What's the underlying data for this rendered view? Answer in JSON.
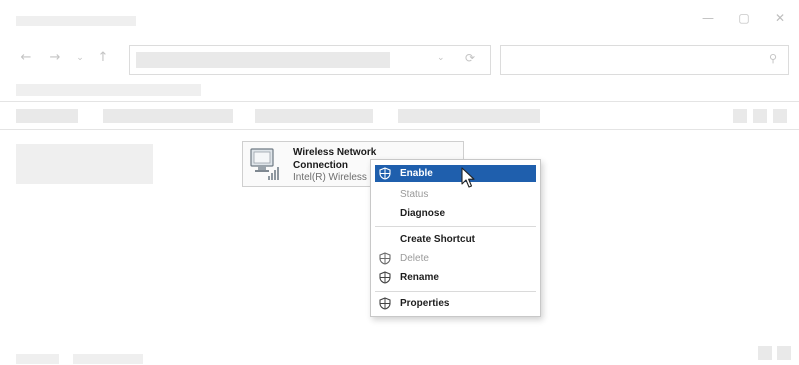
{
  "window": {
    "controls": {
      "minimize": "—",
      "maximize": "▢",
      "close": "✕"
    }
  },
  "navigation": {
    "back": "←",
    "forward": "→",
    "recent": "⌄",
    "up": "↑",
    "address_dropdown": "⌄",
    "refresh": "⟳",
    "search_glyph": "⚲"
  },
  "network_tile": {
    "name": "Wireless Network Connection",
    "adapter": "Intel(R) Wireless",
    "icon": "wireless-adapter-icon"
  },
  "context_menu": {
    "items": [
      {
        "label": "Enable",
        "icon": "shield-icon",
        "state": "highlighted"
      },
      {
        "label": "Status",
        "state": "disabled"
      },
      {
        "label": "Diagnose",
        "state": "enabled"
      },
      {
        "label": "Create Shortcut",
        "state": "enabled"
      },
      {
        "label": "Delete",
        "icon": "shield-icon",
        "state": "disabled"
      },
      {
        "label": "Rename",
        "icon": "shield-icon",
        "state": "enabled"
      },
      {
        "label": "Properties",
        "icon": "shield-icon",
        "state": "enabled"
      }
    ]
  },
  "colors": {
    "highlight": "#1f5fad",
    "placeholder": "#e9e9e9",
    "disabled_text": "#9a9a9a"
  }
}
